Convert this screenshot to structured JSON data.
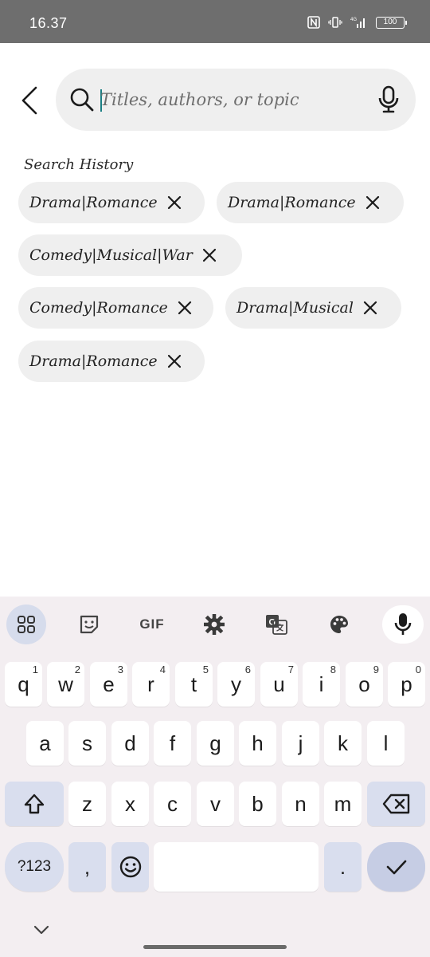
{
  "status_bar": {
    "time": "16.37",
    "network": "4G",
    "battery": "100"
  },
  "search": {
    "placeholder": "Titles, authors, or topic",
    "value": ""
  },
  "history": {
    "title": "Search History",
    "chips": [
      {
        "label": "Drama|Romance"
      },
      {
        "label": "Drama|Romance"
      },
      {
        "label": "Comedy|Musical|War"
      },
      {
        "label": "Comedy|Romance"
      },
      {
        "label": "Drama|Musical"
      },
      {
        "label": "Drama|Romance"
      }
    ]
  },
  "keyboard": {
    "toolbar": {
      "gif": "GIF"
    },
    "row1": [
      {
        "k": "q",
        "hint": "1"
      },
      {
        "k": "w",
        "hint": "2"
      },
      {
        "k": "e",
        "hint": "3"
      },
      {
        "k": "r",
        "hint": "4"
      },
      {
        "k": "t",
        "hint": "5"
      },
      {
        "k": "y",
        "hint": "6"
      },
      {
        "k": "u",
        "hint": "7"
      },
      {
        "k": "i",
        "hint": "8"
      },
      {
        "k": "o",
        "hint": "9"
      },
      {
        "k": "p",
        "hint": "0"
      }
    ],
    "row2": [
      "a",
      "s",
      "d",
      "f",
      "g",
      "h",
      "j",
      "k",
      "l"
    ],
    "row3": [
      "z",
      "x",
      "c",
      "v",
      "b",
      "n",
      "m"
    ],
    "symbols": "?123",
    "comma": ",",
    "period": "."
  }
}
